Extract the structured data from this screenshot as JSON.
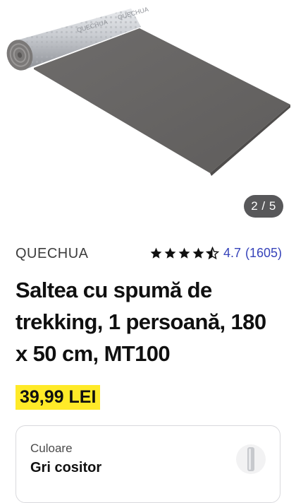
{
  "gallery": {
    "counter": "2 / 5",
    "image_alt": "Saltea cu spumă de trekking gri cositor"
  },
  "product": {
    "brand": "QUECHUA",
    "rating_value": "4.7",
    "rating_count": "(1605)",
    "rating_stars": 4.5,
    "title": "Saltea cu spumă de trekking, 1 persoană, 180 x 50 cm, MT100",
    "price": "39,99 LEI"
  },
  "color_selector": {
    "label": "Culoare",
    "value": "Gri cositor"
  },
  "colors": {
    "price_highlight": "#ffea28",
    "rating_blue": "#3643ba",
    "counter_bg": "#58585a",
    "mat_gray": "#6b6968"
  },
  "icons": {
    "star": "star-icon",
    "half_star": "half-star-icon",
    "swatch": "mat-swatch-icon"
  }
}
